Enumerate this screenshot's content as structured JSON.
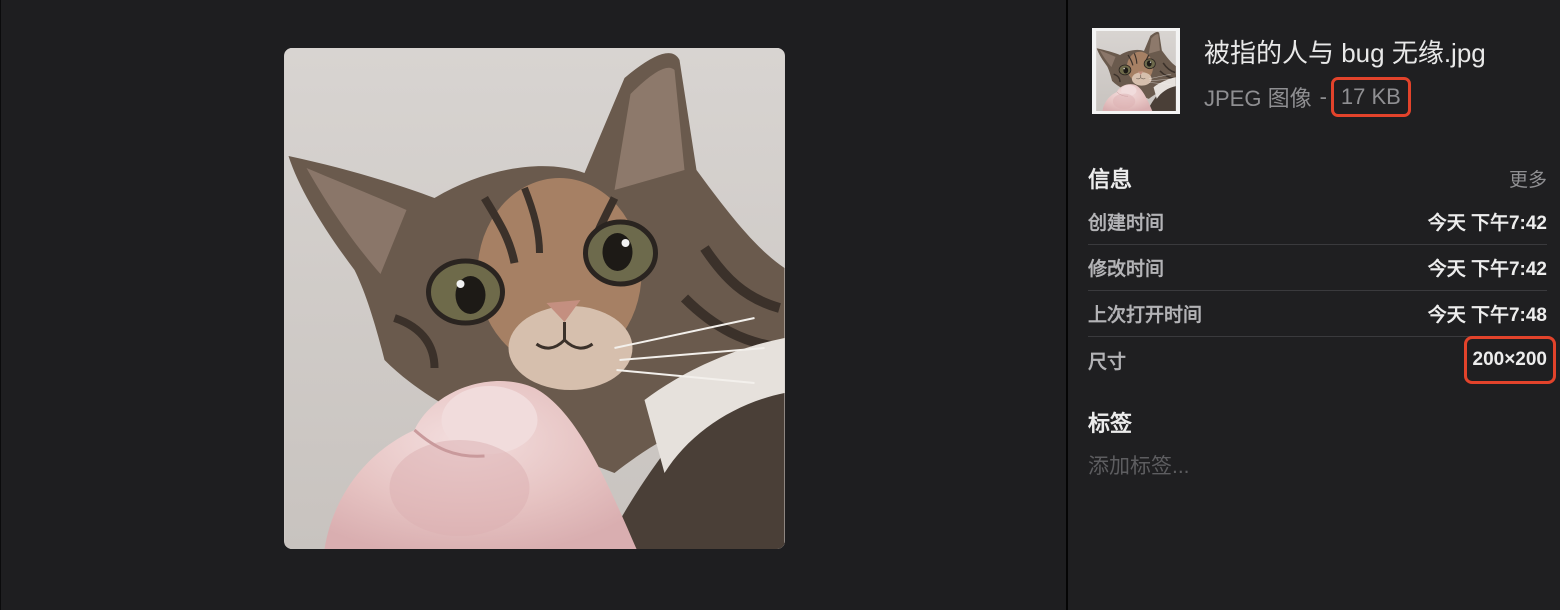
{
  "file": {
    "name": "被指的人与 bug 无缘.jpg",
    "type": "JPEG 图像",
    "separator": "-",
    "size": "17 KB"
  },
  "info": {
    "title": "信息",
    "more": "更多",
    "rows": [
      {
        "label": "创建时间",
        "value": "今天 下午7:42"
      },
      {
        "label": "修改时间",
        "value": "今天 下午7:42"
      },
      {
        "label": "上次打开时间",
        "value": "今天 下午7:48"
      },
      {
        "label": "尺寸",
        "value": "200×200"
      }
    ]
  },
  "tags": {
    "title": "标签",
    "placeholder": "添加标签..."
  },
  "colors": {
    "background": "#1e1e20",
    "highlight": "#e2432b",
    "primary_text": "#e8e8e8",
    "secondary_text": "#8f8f92"
  }
}
